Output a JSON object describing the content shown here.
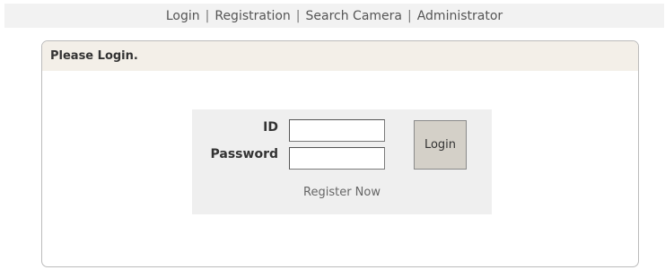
{
  "nav": {
    "items": [
      "Login",
      "Registration",
      "Search Camera",
      "Administrator"
    ],
    "separator": "|"
  },
  "panel": {
    "title": "Please Login."
  },
  "form": {
    "id_label": "ID",
    "password_label": "Password",
    "id_value": "",
    "password_value": "",
    "login_button": "Login",
    "register_link": "Register Now"
  }
}
